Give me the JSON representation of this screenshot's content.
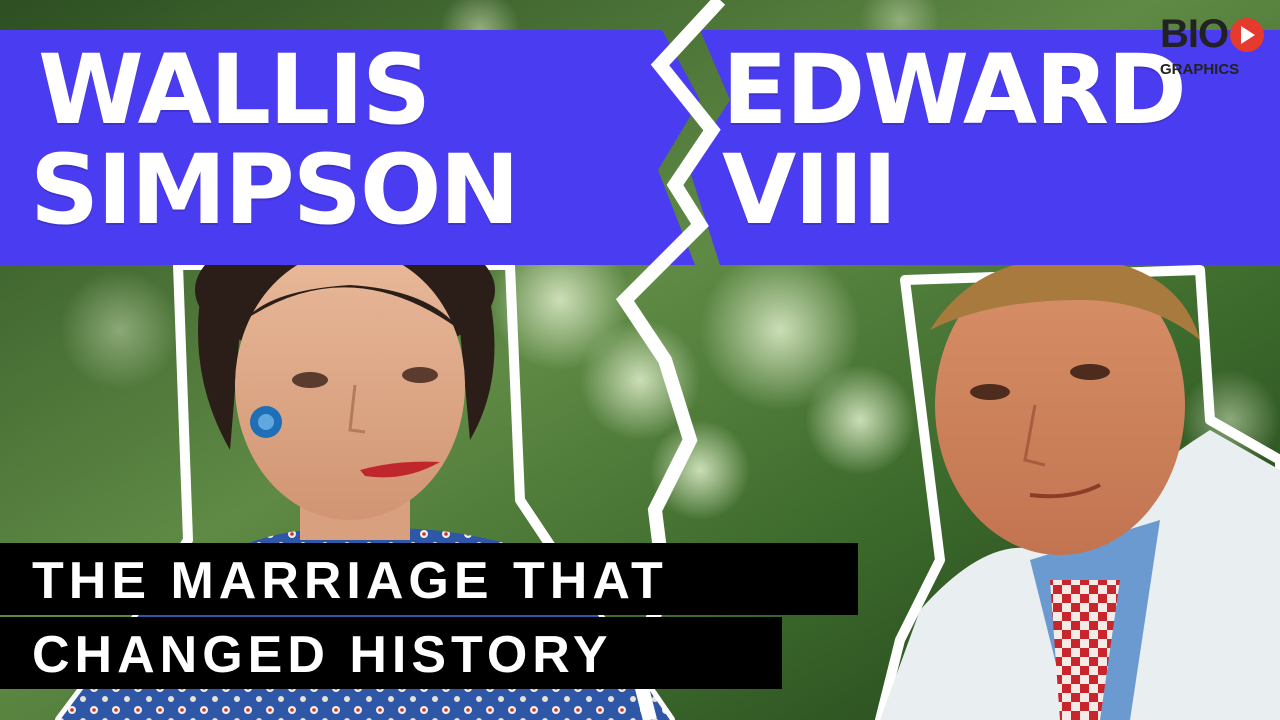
{
  "left_name": {
    "line1": "WALLIS",
    "line2": "SIMPSON"
  },
  "right_name": {
    "line1": "EDWARD",
    "line2": "VIII"
  },
  "subtitle": {
    "line1": "THE MARRIAGE THAT",
    "line2": "CHANGED HISTORY"
  },
  "logo": {
    "top": "BIO",
    "bottom": "GRAPHICS",
    "icon": "play-icon"
  },
  "colors": {
    "banner": "#4a3cf0",
    "outline": "#ffffff",
    "caption_bg": "#000000",
    "logo_accent": "#e63a2e"
  }
}
